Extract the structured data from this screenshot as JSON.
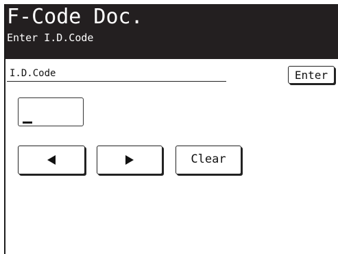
{
  "header": {
    "title": "F-Code Doc.",
    "subtitle": "Enter I.D.Code"
  },
  "field": {
    "label": "I.D.Code",
    "value": ""
  },
  "buttons": {
    "enter_label": "Enter",
    "left_icon": "arrow-left-icon",
    "right_icon": "arrow-right-icon",
    "clear_label": "Clear"
  },
  "colors": {
    "header_background": "#231f20",
    "header_text": "#ffffff",
    "border": "#222222"
  }
}
